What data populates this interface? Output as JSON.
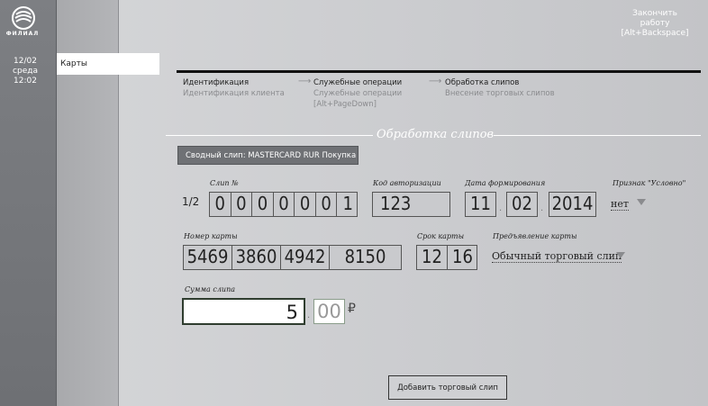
{
  "sidebar": {
    "logo_text": "ФИЛИАЛ",
    "date": "12/02",
    "weekday": "среда",
    "time": "12:02",
    "nav_item": "Карты"
  },
  "header": {
    "exit_line1": "Закончить",
    "exit_line2": "работу",
    "exit_hint": "[Alt+Backspace]"
  },
  "steps": [
    {
      "title": "Идентификация",
      "subtitle": "Идентификация клиента",
      "hint": ""
    },
    {
      "title": "Служебные операции",
      "subtitle": "Служебные операции",
      "hint": "[Alt+PageDown]"
    },
    {
      "title": "Обработка слипов",
      "subtitle": "Внесение торговых слипов",
      "hint": ""
    }
  ],
  "section": {
    "title": "Обработка слипов",
    "summary_button": "Сводный слип: MASTERCARD RUR Покупка"
  },
  "form": {
    "counter": "1/2",
    "slip_label": "Слип №",
    "slip_digits": [
      "0",
      "0",
      "0",
      "0",
      "0",
      "0",
      "1"
    ],
    "auth_label": "Код авторизации",
    "auth_code": "123",
    "date_label": "Дата формирования",
    "date_day": "11",
    "date_month": "02",
    "date_year": "2014",
    "conditional_label": "Признак \"Условно\"",
    "conditional_value": "нет",
    "card_label": "Номер карты",
    "card_groups": [
      "5469",
      "3860",
      "4942",
      "8150"
    ],
    "expiry_label": "Срок карты",
    "expiry_month": "12",
    "expiry_year": "16",
    "presentation_label": "Предъявление карты",
    "presentation_value": "Обычный торговый слип",
    "amount_label": "Сумма слипа",
    "amount_main": "5",
    "amount_cents": "00",
    "currency_symbol": "₽"
  },
  "actions": {
    "add_slip": "Добавить торговый слип"
  },
  "colors": {
    "left_rail": "#76787c",
    "nav_column": "#aeafb2",
    "summary_button": "#6f7175",
    "active_field_border": "#2f3d2f"
  }
}
